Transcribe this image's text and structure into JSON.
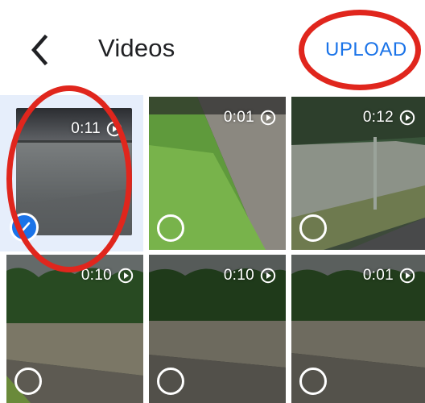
{
  "header": {
    "title": "Videos",
    "upload_label": "UPLOAD"
  },
  "videos": [
    {
      "duration": "0:11",
      "selected": true
    },
    {
      "duration": "0:01",
      "selected": false
    },
    {
      "duration": "0:12",
      "selected": false
    },
    {
      "duration": "0:10",
      "selected": false
    },
    {
      "duration": "0:10",
      "selected": false
    },
    {
      "duration": "0:01",
      "selected": false
    }
  ],
  "icons": {
    "back": "chevron-left-icon",
    "play": "play-circle-icon",
    "check": "check-icon"
  },
  "colors": {
    "accent": "#1a73e8",
    "annotation": "#e0261d"
  }
}
